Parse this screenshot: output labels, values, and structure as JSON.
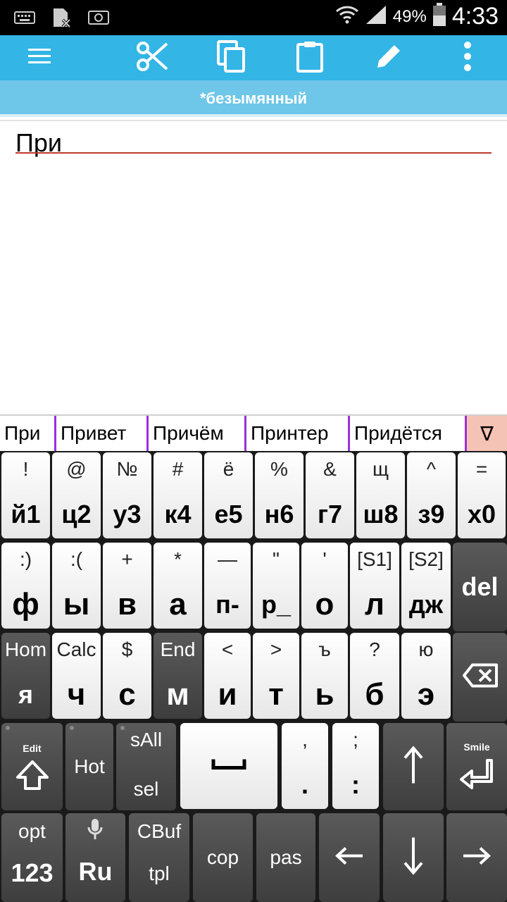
{
  "status_bar": {
    "battery_percent": "49%",
    "time": "4:33",
    "icons": [
      "keyboard-icon",
      "sim-x-icon",
      "screenshot-icon",
      "wifi-icon",
      "signal-icon",
      "battery-icon"
    ]
  },
  "toolbar": {
    "icons": [
      "menu-icon",
      "cut-icon",
      "copy-icon",
      "paste-icon",
      "edit-icon",
      "overflow-icon"
    ]
  },
  "title": "*безымянный",
  "editor": {
    "text": "При"
  },
  "suggestions": [
    "При",
    "Привет",
    "Причём",
    "Принтер",
    "Придётся"
  ],
  "suggestion_more": "∇",
  "colors": {
    "toolbar": "#33b5e5",
    "titlebar": "#6ec6e8",
    "divider": "#9b30d9",
    "more": "#f5c3b5"
  },
  "keyboard": {
    "row1": [
      {
        "top": "!",
        "main": "й1"
      },
      {
        "top": "@",
        "main": "ц2"
      },
      {
        "top": "№",
        "main": "у3"
      },
      {
        "top": "#",
        "main": "к4"
      },
      {
        "top": "ё",
        "main": "е5"
      },
      {
        "top": "%",
        "main": "н6"
      },
      {
        "top": "&",
        "main": "г7"
      },
      {
        "top": "щ",
        "main": "ш8"
      },
      {
        "top": "^",
        "main": "з9"
      },
      {
        "top": "=",
        "main": "х0"
      }
    ],
    "row2": [
      {
        "top": ":)",
        "main": "ф"
      },
      {
        "top": ":(",
        "main": "ы"
      },
      {
        "top": "+",
        "main": "в"
      },
      {
        "top": "*",
        "main": "а"
      },
      {
        "top": "—",
        "main": "п-"
      },
      {
        "top": "\"",
        "main": "р_"
      },
      {
        "top": "'",
        "main": "о"
      },
      {
        "top": "[S1]",
        "main": "л"
      },
      {
        "top": "[S2]",
        "main": "дж"
      }
    ],
    "del": "del",
    "row3": [
      {
        "top": "Hom",
        "main": "я",
        "dark": true
      },
      {
        "top": "Calc",
        "main": "ч"
      },
      {
        "top": "$",
        "main": "с"
      },
      {
        "top": "End",
        "main": "м",
        "dark": true
      },
      {
        "top": "<",
        "main": "и"
      },
      {
        "top": ">",
        "main": "т"
      },
      {
        "top": "ъ",
        "main": "ь"
      },
      {
        "top": "?",
        "main": "б"
      },
      {
        "top": "ю",
        "main": "э"
      }
    ],
    "row4": {
      "shift_label": "Edit",
      "hot": "Hot",
      "sall": "sAll",
      "sel": "sel",
      "comma": ",",
      "period": ".",
      "semicolon": ";",
      "colon": ":",
      "enter_label": "Smile"
    },
    "row5": {
      "opt": "opt",
      "num": "123",
      "lang": "Ru",
      "cbuf": "CBuf",
      "tpl": "tpl",
      "cop": "cop",
      "pas": "pas"
    }
  }
}
